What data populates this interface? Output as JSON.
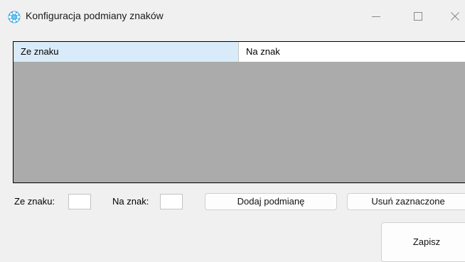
{
  "window": {
    "title": "Konfiguracja podmiany znaków",
    "icon": "snowflake-app-icon",
    "controls": {
      "minimize": "minimize-icon",
      "maximize": "maximize-icon",
      "close": "close-icon"
    }
  },
  "grid": {
    "columns": [
      "Ze znaku",
      "Na znak"
    ],
    "rows": []
  },
  "form": {
    "from_label": "Ze znaku:",
    "from_value": "",
    "to_label": "Na znak:",
    "to_value": ""
  },
  "buttons": {
    "add": "Dodaj podmianę",
    "remove": "Usuń zaznaczone",
    "save": "Zapisz"
  },
  "colors": {
    "background": "#f0f0f0",
    "grid_background": "#ababab",
    "selected_header": "#d9ebf9",
    "icon_accent": "#3fa9e6"
  }
}
